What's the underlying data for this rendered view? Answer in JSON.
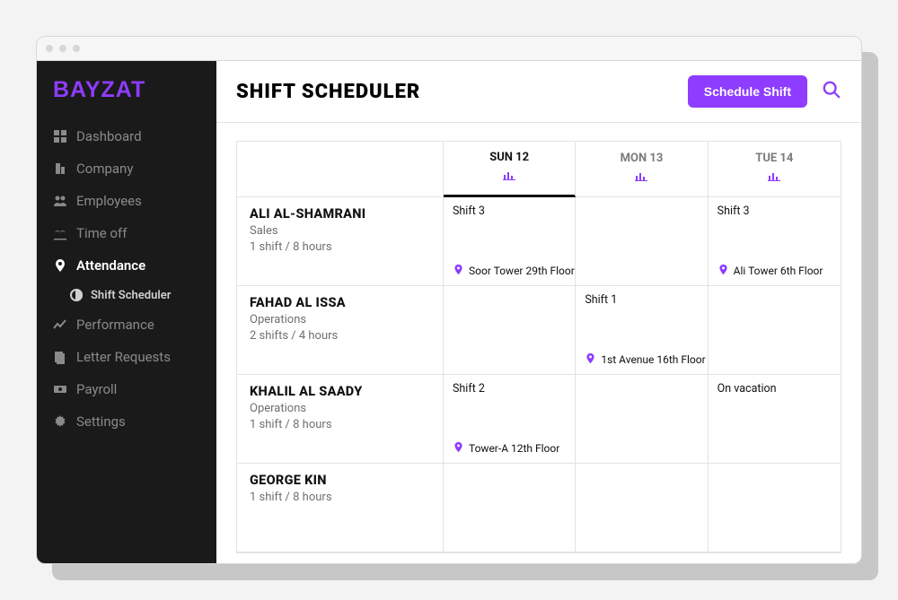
{
  "brand": "BAYZAT",
  "page_title": "SHIFT SCHEDULER",
  "primary_button": "Schedule Shift",
  "sidebar": {
    "items": [
      {
        "id": "dashboard",
        "label": "Dashboard",
        "icon": "dashboard"
      },
      {
        "id": "company",
        "label": "Company",
        "icon": "building"
      },
      {
        "id": "employees",
        "label": "Employees",
        "icon": "people"
      },
      {
        "id": "timeoff",
        "label": "Time off",
        "icon": "palm"
      },
      {
        "id": "attendance",
        "label": "Attendance",
        "icon": "map-pin",
        "active": true,
        "children": [
          {
            "id": "shift-scheduler",
            "label": "Shift Scheduler",
            "icon": "half-circle"
          }
        ]
      },
      {
        "id": "performance",
        "label": "Performance",
        "icon": "trend"
      },
      {
        "id": "letters",
        "label": "Letter Requests",
        "icon": "letter"
      },
      {
        "id": "payroll",
        "label": "Payroll",
        "icon": "cash"
      },
      {
        "id": "settings",
        "label": "Settings",
        "icon": "gear"
      }
    ]
  },
  "columns": [
    {
      "label": "SUN 12",
      "active": true
    },
    {
      "label": "MON 13",
      "active": false
    },
    {
      "label": "TUE 14",
      "active": false
    }
  ],
  "rows": [
    {
      "name": "ALI AL-SHAMRANI",
      "dept": "Sales",
      "summary": "1 shift / 8 hours",
      "cells": [
        {
          "title": "Shift 3",
          "location": "Soor Tower 29th Floor"
        },
        {},
        {
          "title": "Shift 3",
          "location": "Ali Tower 6th Floor"
        }
      ]
    },
    {
      "name": "FAHAD AL ISSA",
      "dept": "Operations",
      "summary": "2 shifts / 4 hours",
      "cells": [
        {},
        {
          "title": "Shift 1",
          "location": "1st Avenue 16th Floor"
        },
        {}
      ]
    },
    {
      "name": "KHALIL AL SAADY",
      "dept": "Operations",
      "summary": "1 shift / 8 hours",
      "cells": [
        {
          "title": "Shift 2",
          "location": "Tower-A 12th Floor"
        },
        {},
        {
          "status": "On vacation"
        }
      ]
    },
    {
      "name": "GEORGE KIN",
      "dept": "",
      "summary": "1 shift / 8 hours",
      "cells": [
        {},
        {},
        {}
      ]
    }
  ]
}
